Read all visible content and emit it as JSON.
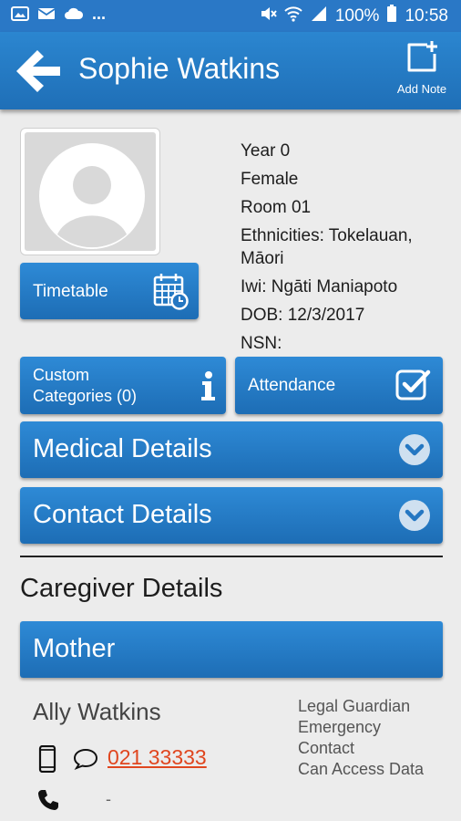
{
  "status_bar": {
    "battery": "100%",
    "time": "10:58",
    "overflow": "...",
    "left_icons": [
      "gallery-icon",
      "mail-icon",
      "cloud-icon"
    ],
    "right_icons": [
      "mute-icon",
      "wifi-icon",
      "signal-icon",
      "battery-icon"
    ]
  },
  "app_bar": {
    "title": "Sophie Watkins",
    "add_note_label": "Add Note",
    "color": "#2a78c6"
  },
  "student": {
    "year": "Year 0",
    "gender": "Female",
    "room": "Room 01",
    "ethnicities": "Ethnicities: Tokelauan, Māori",
    "iwi": "Iwi: Ngāti Maniapoto",
    "dob": "DOB: 12/3/2017",
    "nsn": "NSN:"
  },
  "buttons": {
    "timetable": "Timetable",
    "custom_categories": "Custom Categories (0)",
    "attendance": "Attendance"
  },
  "sections": {
    "medical": "Medical Details",
    "contact": "Contact Details"
  },
  "caregiver": {
    "heading": "Caregiver Details",
    "relation": "Mother",
    "name": "Ally Watkins",
    "roles": [
      "Legal Guardian",
      "Emergency Contact",
      "Can Access Data"
    ],
    "mobile": "021 33333",
    "landline": "-"
  },
  "colors": {
    "button_blue": "#2a7cc8",
    "link_red": "#e0461f",
    "background": "#ececec"
  }
}
